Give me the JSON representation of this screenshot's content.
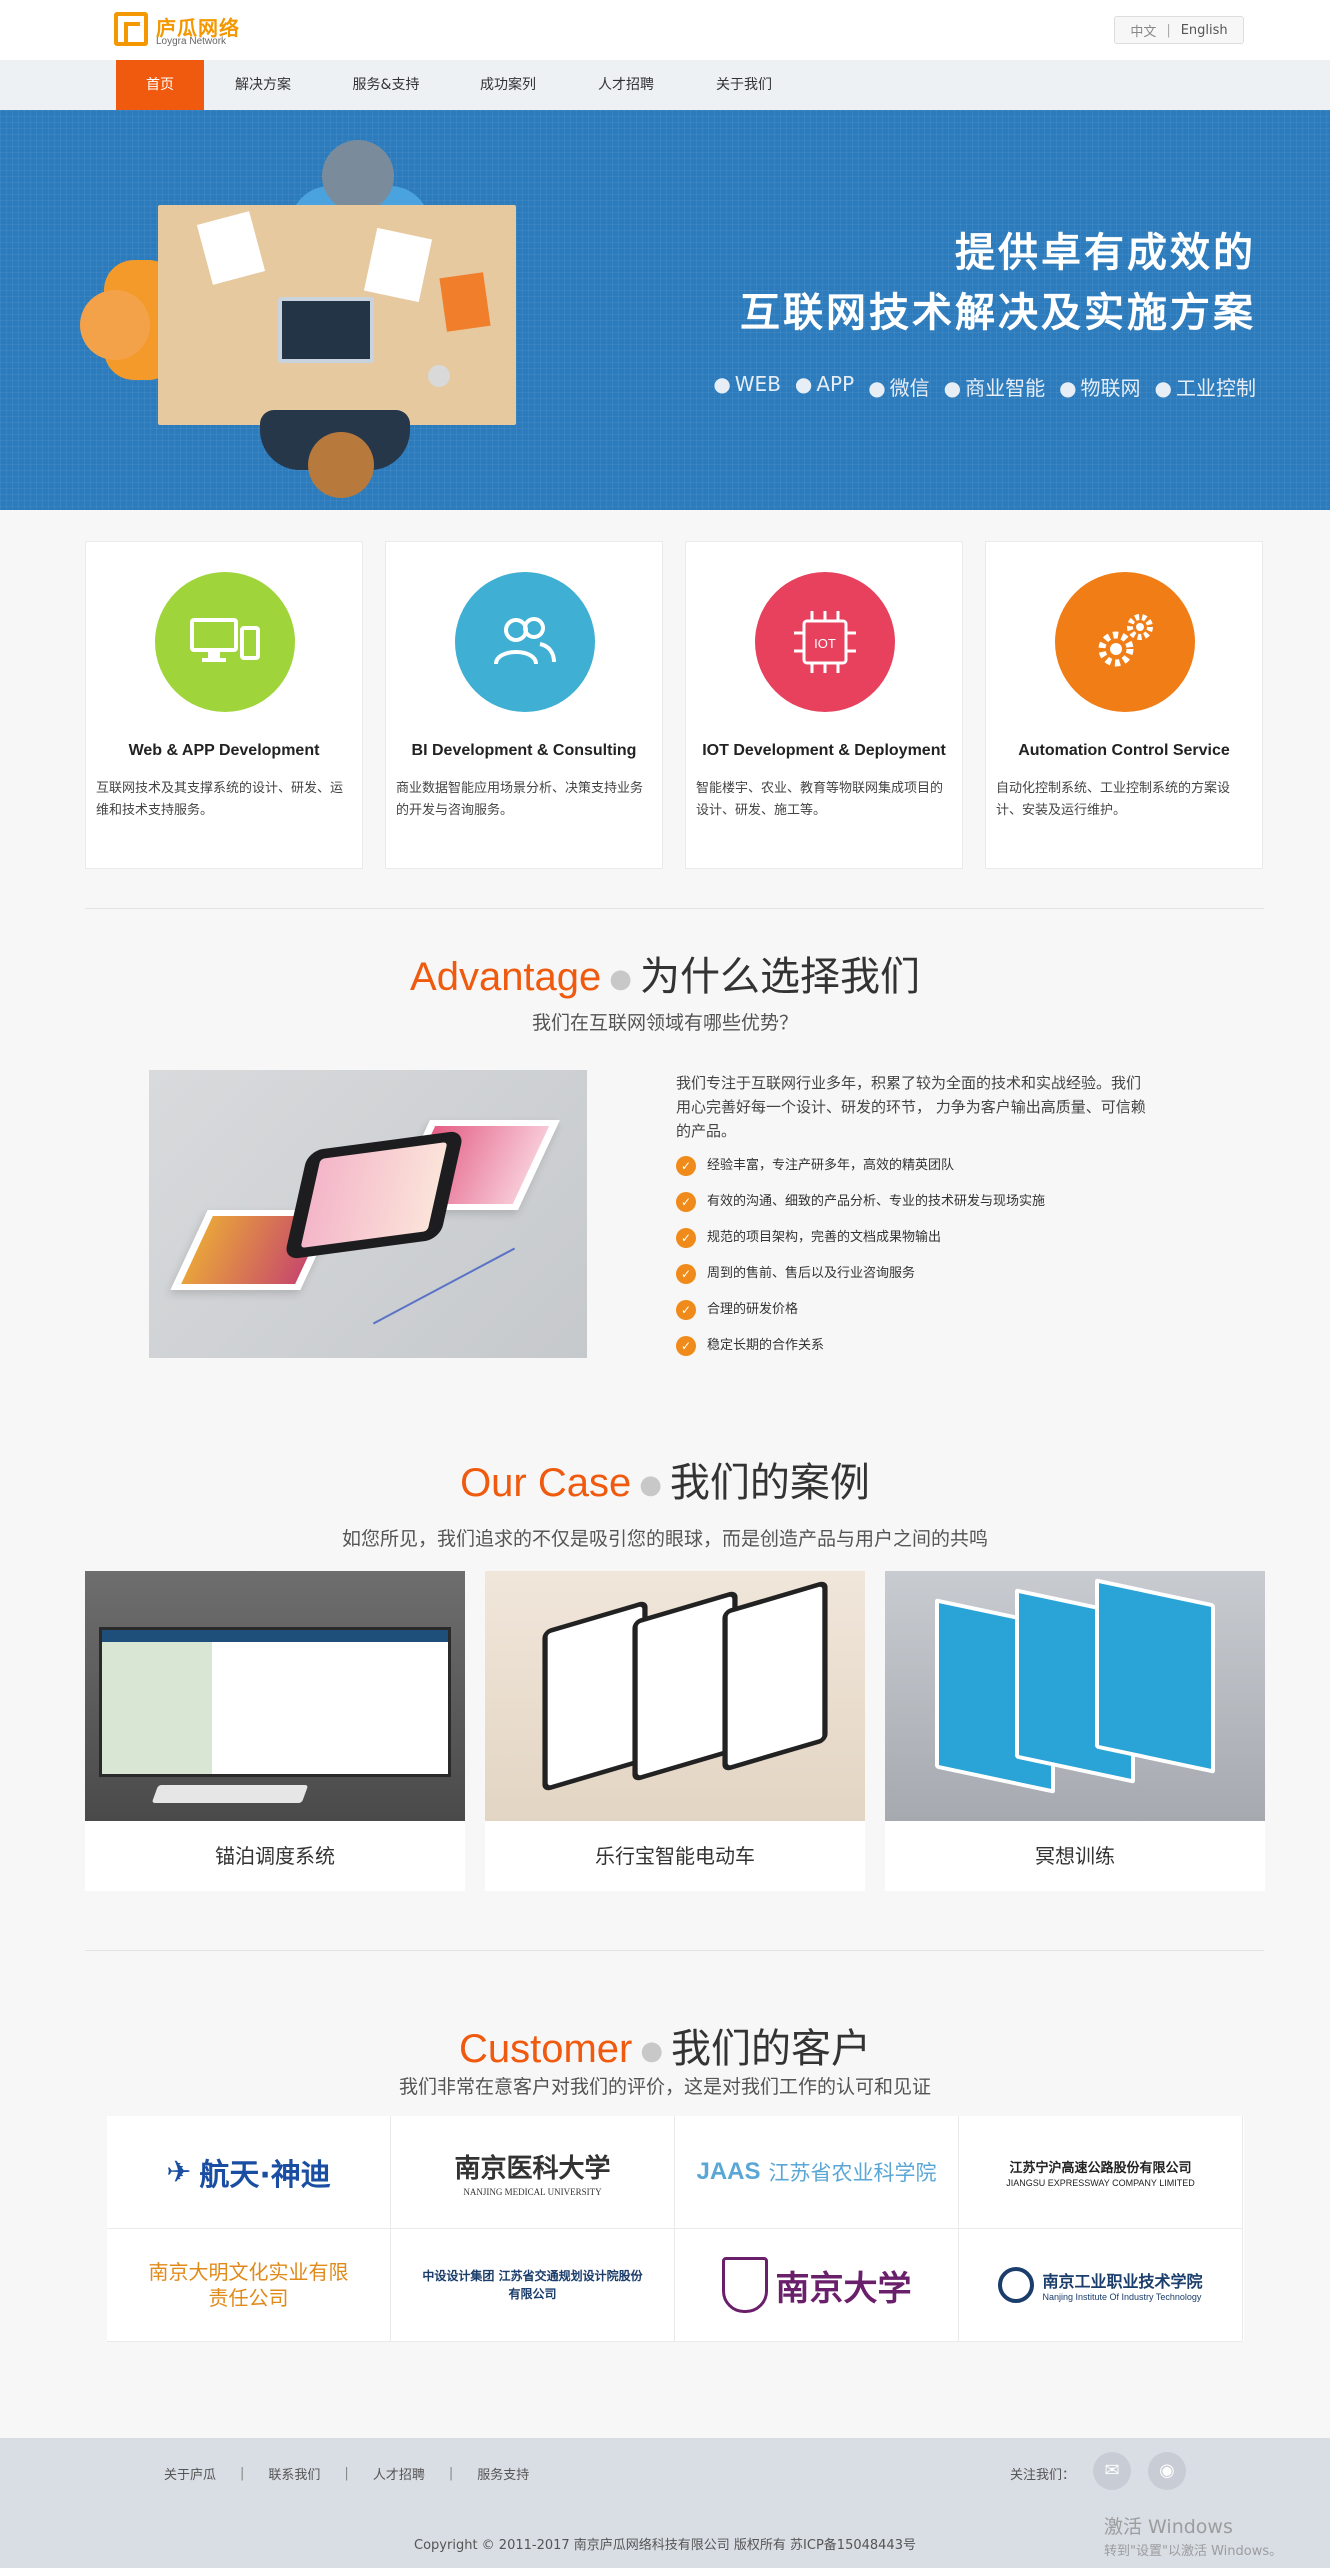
{
  "brand": {
    "name": "庐瓜网络",
    "sub": "Loygra Network"
  },
  "lang": {
    "cn": "中文",
    "sep": "|",
    "en": "English"
  },
  "nav": [
    {
      "label": "首页",
      "active": true
    },
    {
      "label": "解决方案"
    },
    {
      "label": "服务&支持"
    },
    {
      "label": "成功案列"
    },
    {
      "label": "人才招聘"
    },
    {
      "label": "关于我们"
    }
  ],
  "banner": {
    "line1": "提供卓有成效的",
    "line2": "互联网技术解决及实施方案",
    "tags": [
      "WEB",
      "APP",
      "微信",
      "商业智能",
      "物联网",
      "工业控制"
    ]
  },
  "services": [
    {
      "title": "Web & APP Development",
      "desc": "互联网技术及其支撑系统的设计、研发、运维和技术支持服务。",
      "color": "#9fd43b",
      "icon": "monitor-phone-icon"
    },
    {
      "title": "BI Development & Consulting",
      "desc": "商业数据智能应用场景分析、决策支持业务的开发与咨询服务。",
      "color": "#3fafd4",
      "icon": "users-icon"
    },
    {
      "title": "IOT Development & Deployment",
      "desc": "智能楼宇、农业、教育等物联网集成项目的设计、研发、施工等。",
      "color": "#e7415e",
      "icon": "iot-chip-icon",
      "badge": "IOT"
    },
    {
      "title": "Automation Control Service",
      "desc": "自动化控制系统、工业控制系统的方案设计、安装及运行维护。",
      "color": "#f07d16",
      "icon": "gears-icon"
    }
  ],
  "advantage": {
    "en": "Advantage",
    "cn": "为什么选择我们",
    "sub": "我们在互联网领域有哪些优势？",
    "intro": "我们专注于互联网行业多年，积累了较为全面的技术和实战经验。我们用心完善好每一个设计、研发的环节， 力争为客户输出高质量、可信赖的产品。",
    "points": [
      "经验丰富，专注产研多年，高效的精英团队",
      "有效的沟通、细致的产品分析、专业的技术研发与现场实施",
      "规范的项目架构，完善的文档成果物输出",
      "周到的售前、售后以及行业咨询服务",
      "合理的研发价格",
      "稳定长期的合作关系"
    ]
  },
  "cases": {
    "en": "Our Case",
    "cn": "我们的案例",
    "sub": "如您所见，我们追求的不仅是吸引您的眼球，而是创造产品与用户之间的共鸣",
    "items": [
      {
        "label": "锚泊调度系统"
      },
      {
        "label": "乐行宝智能电动车"
      },
      {
        "label": "冥想训练"
      }
    ]
  },
  "customers": {
    "en": "Customer",
    "cn": "我们的客户",
    "sub": "我们非常在意客户对我们的评价，这是对我们工作的认可和见证",
    "items": [
      {
        "name": "航天·神迪",
        "color": "#1a4ea3"
      },
      {
        "name": "南京医科大学",
        "en": "NANJING MEDICAL UNIVERSITY",
        "color": "#333333"
      },
      {
        "name": "江苏省农业科学院",
        "mark": "JAAS",
        "color": "#5aa7d6"
      },
      {
        "name": "江苏宁沪高速公路股份有限公司",
        "en": "JIANGSU EXPRESSWAY COMPANY LIMITED",
        "color": "#222222"
      },
      {
        "name": "南京大明文化实业有限责任公司",
        "color": "#e08a1a"
      },
      {
        "name": "中设设计集团 江苏省交通规划设计院股份有限公司",
        "color": "#1a3d6b"
      },
      {
        "name": "南京大学",
        "color": "#6a1f6a"
      },
      {
        "name": "南京工业职业技术学院",
        "en": "Nanjing Institute Of Industry Technology",
        "color": "#1a3d6b"
      }
    ]
  },
  "footer": {
    "links": [
      "关于庐瓜",
      "联系我们",
      "人才招聘",
      "服务支持"
    ],
    "follow": "关注我们：",
    "copyright": "Copyright © 2011-2017 南京庐瓜网络科技有限公司 版权所有 苏ICP备15048443号"
  },
  "os_watermark": {
    "line1": "激活 Windows",
    "line2": "转到\"设置\"以激活 Windows。"
  }
}
